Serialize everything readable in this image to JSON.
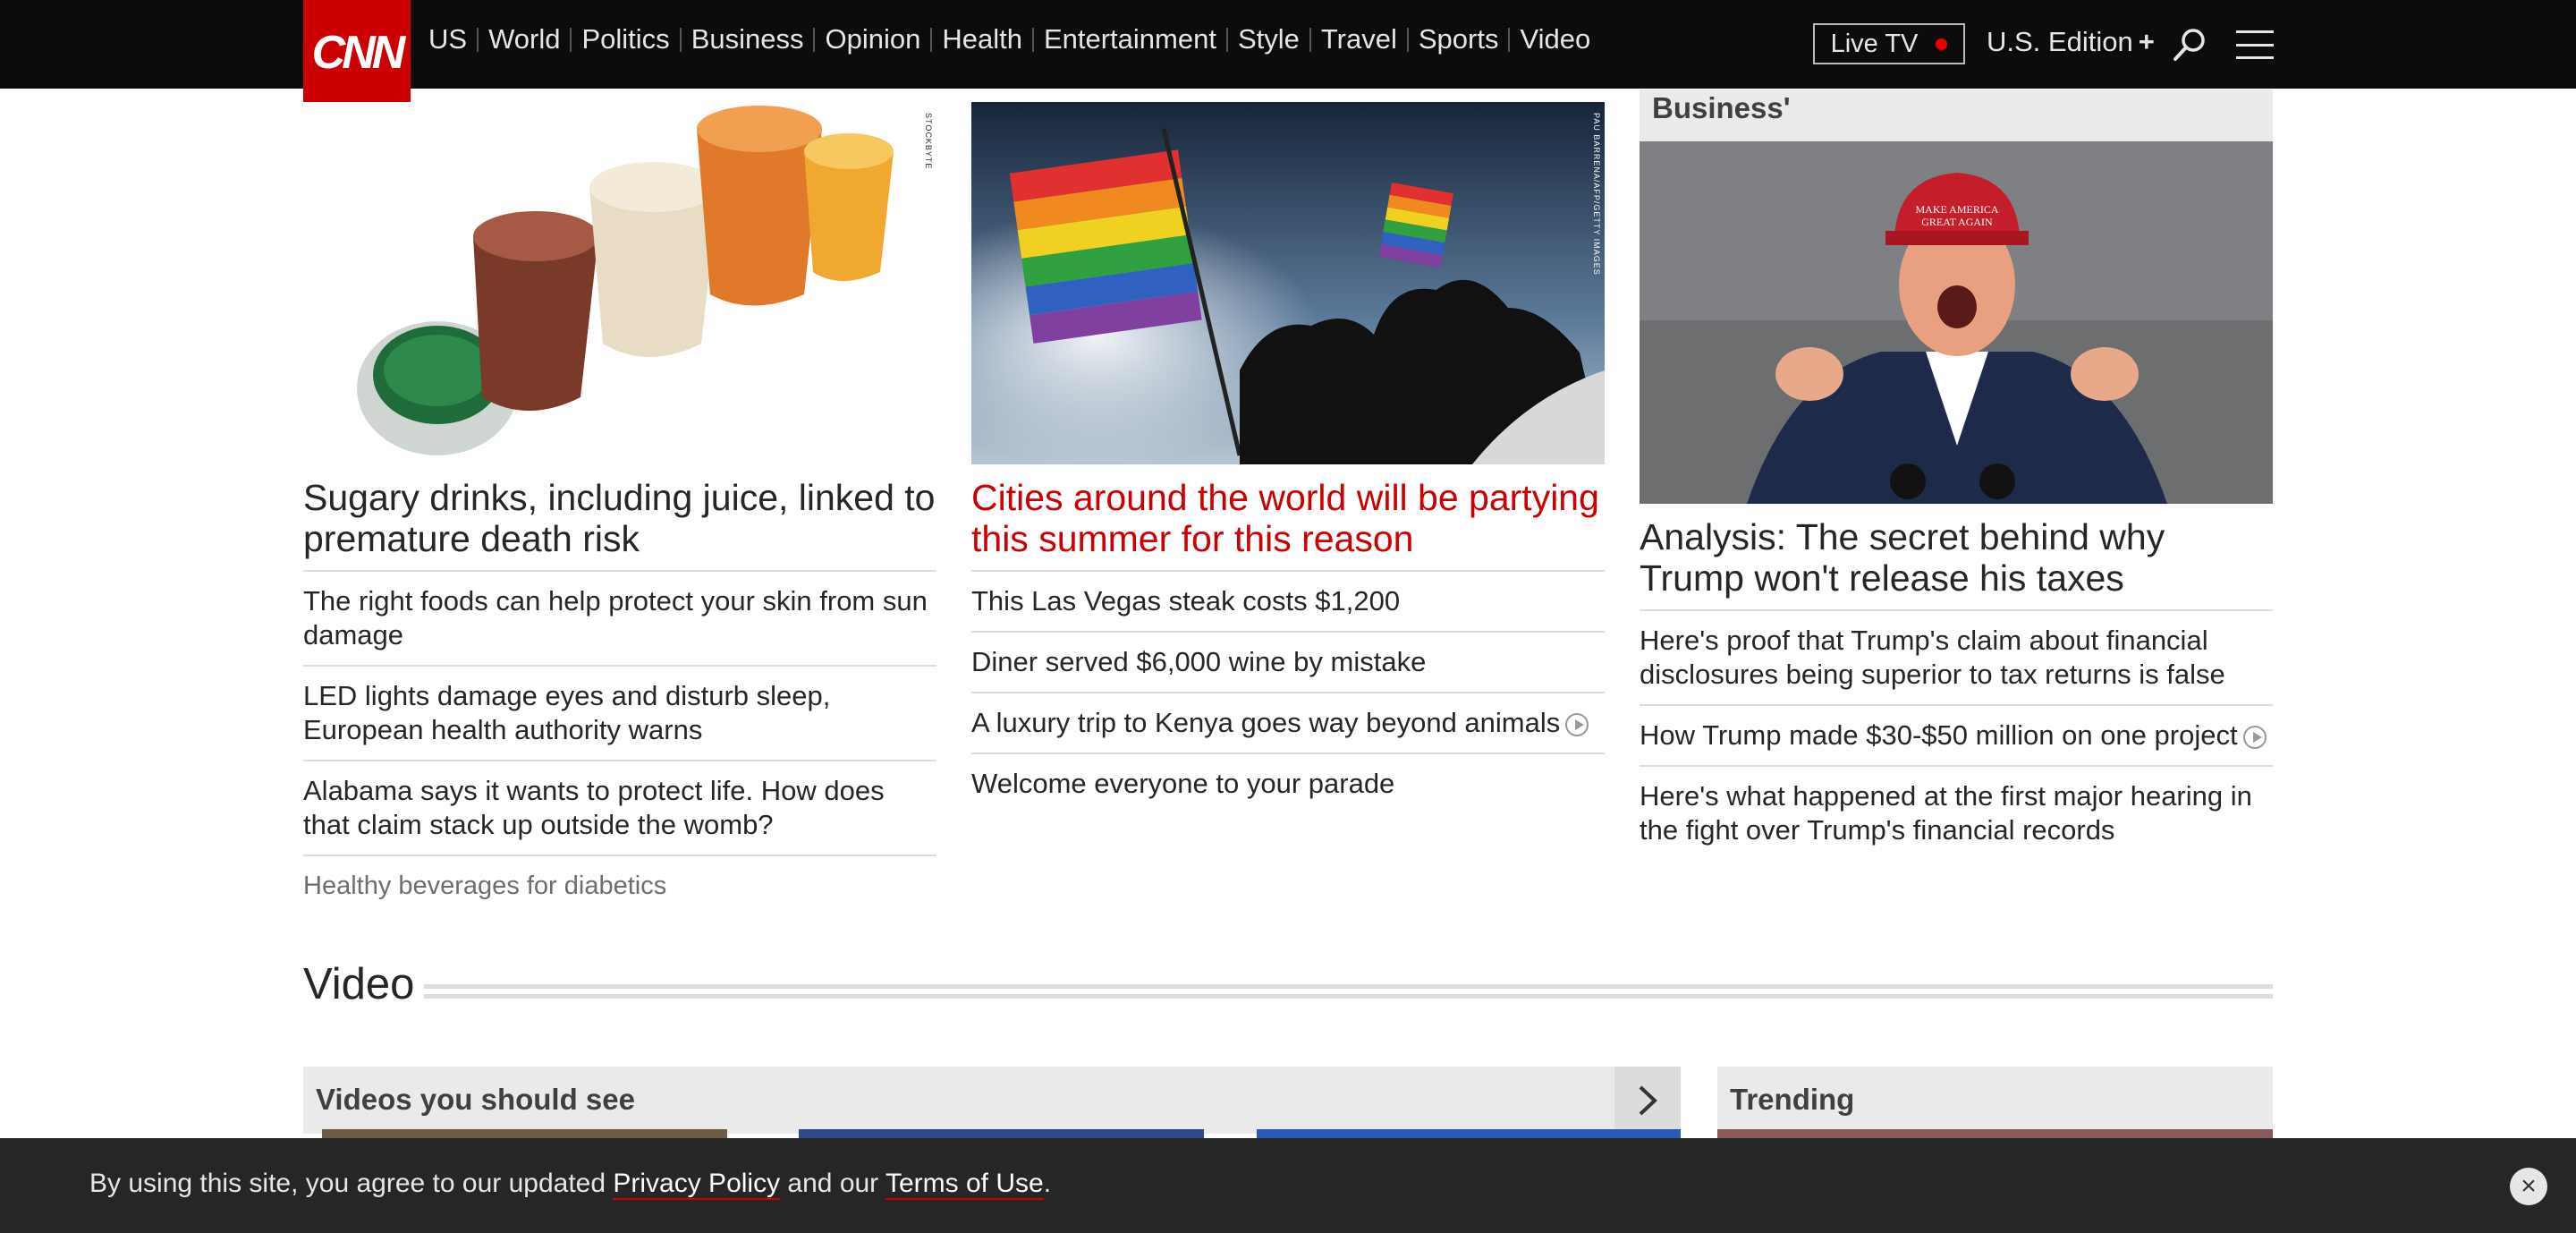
{
  "nav": {
    "logo": "CNN",
    "links": [
      "US",
      "World",
      "Politics",
      "Business",
      "Opinion",
      "Health",
      "Entertainment",
      "Style",
      "Travel",
      "Sports",
      "Video"
    ],
    "live_tv": "Live TV",
    "edition": "U.S. Edition",
    "edition_symbol": "+"
  },
  "columns": [
    {
      "image_alt": "Glasses of colorful juices",
      "credit": "STOCKBYTE",
      "headline": "Sugary drinks, including juice, linked to premature death risk",
      "items": [
        "The right foods can help protect your skin from sun damage",
        "LED lights damage eyes and disturb sleep, European health authority warns",
        "Alabama says it wants to protect life. How does that claim stack up outside the womb?"
      ],
      "muted_item": "Healthy beverages for diabetics"
    },
    {
      "image_alt": "Rainbow flags at a parade",
      "credit": "PAU BARRENA/AFP/GETTY IMAGES",
      "headline": "Cities around the world will be partying this summer for this reason",
      "items": [
        "This Las Vegas steak costs $1,200",
        "Diner served $6,000 wine by mistake",
        "A luxury trip to Kenya goes way beyond animals",
        "Welcome everyone to your parade"
      ]
    },
    {
      "section_label": "Business'",
      "image_alt": "Trump speaking at a rally",
      "headline": "Analysis: The secret behind why Trump won't release his taxes",
      "items": [
        "Here's proof that Trump's claim about financial disclosures being superior to tax returns is false",
        "How Trump made $30-$50 million on one project",
        "Here's what happened at the first major hearing in the fight over Trump's financial records"
      ]
    }
  ],
  "video": {
    "title": "Video",
    "videos_label": "Videos you should see",
    "trending_label": "Trending"
  },
  "cookie": {
    "prefix": "By using this site, you agree to our updated ",
    "privacy": "Privacy Policy",
    "middle": " and our ",
    "terms": "Terms of Use",
    "suffix": "."
  },
  "colors": {
    "brand_red": "#cc0000",
    "nav_bg": "#0c0c0c",
    "cookie_bg": "#262626"
  }
}
